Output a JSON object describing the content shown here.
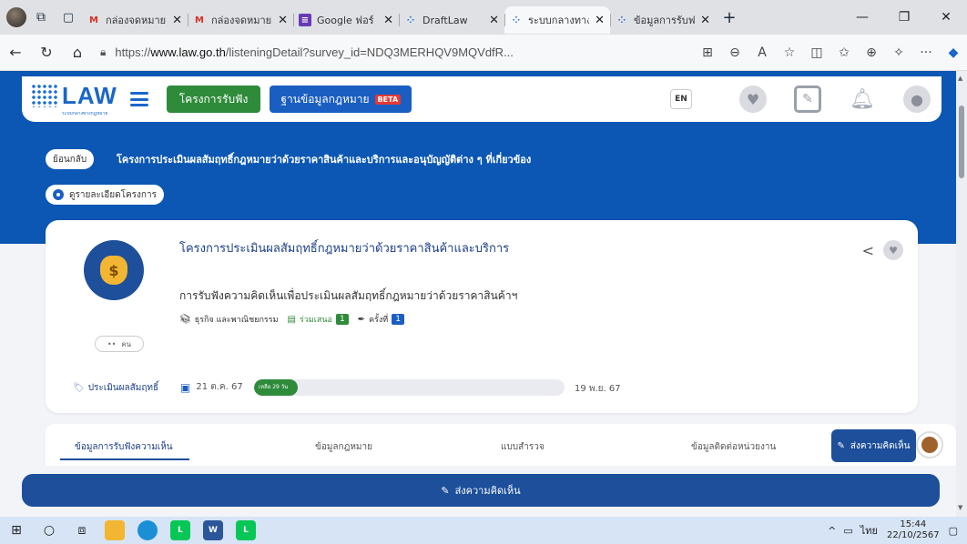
{
  "browser": {
    "tabs": [
      {
        "label": "กล่องจดหมาย",
        "favicon": "gmail-icon",
        "color": "#d93025",
        "active": false
      },
      {
        "label": "กล่องจดหมาย",
        "favicon": "gmail-icon",
        "color": "#d93025",
        "active": false
      },
      {
        "label": "Google ฟอร์",
        "favicon": "google-forms-icon",
        "color": "#673ab7",
        "active": false
      },
      {
        "label": "DraftLaw",
        "favicon": "law-icon",
        "color": "#1a66c9",
        "active": false
      },
      {
        "label": "ระบบกลางทาง",
        "favicon": "law-icon",
        "color": "#1a66c9",
        "active": true
      },
      {
        "label": "ข้อมูลการรับฟ",
        "favicon": "law-icon",
        "color": "#1a66c9",
        "active": false
      }
    ],
    "new_tab": "+",
    "url_prefix": "https://",
    "url_host": "www.law.go.th",
    "url_path": "/listeningDetail?survey_id=NDQ3MERHQV9MQVdfR..."
  },
  "site": {
    "logo_text": "LAW",
    "logo_sub": "ระบบกลางทางกฎหมาย",
    "btn_listening": "โครงการรับฟัง",
    "btn_database": "ฐานข้อมูลกฎหมาย",
    "beta": "BETA",
    "lang": "EN"
  },
  "banner": {
    "back": "ย้อนกลับ",
    "title": "โครงการประเมินผลสัมฤทธิ์กฎหมายว่าด้วยราคาสินค้าและบริการและอนุบัญญัติต่าง ๆ ที่เกี่ยวข้อง",
    "detail": "ดูรายละเอียดโครงการ"
  },
  "card": {
    "title": "โครงการประเมินผลสัมฤทธิ์กฎหมายว่าด้วยราคาสินค้าและบริการ",
    "subtitle": "การรับฟังความคิดเห็นเพื่อประเมินผลสัมฤทธิ์กฎหมายว่าด้วยราคาสินค้าฯ",
    "category": "ธุรกิจ และพาณิชยกรรม",
    "joined_label": "ร่วมเสนอ",
    "joined_count": "1",
    "round_label": "ครั้งที่",
    "round_count": "1",
    "people": "คน",
    "type": "ประเมินผลสัมฤทธิ์",
    "date_start": "21 ต.ค. 67",
    "remaining": "เหลือ 29 วัน",
    "date_end": "19 พ.ย. 67",
    "progress": 0.08
  },
  "tabs": [
    {
      "label": "ข้อมูลการรับฟังความเห็น",
      "active": true
    },
    {
      "label": "ข้อมูลกฎหมาย",
      "active": false
    },
    {
      "label": "แบบสำรวจ",
      "active": false
    },
    {
      "label": "ข้อมูลติดต่อหน่วยงาน",
      "active": false
    }
  ],
  "send_small": "ส่งความคิดเห็น",
  "send_big": "ส่งความคิดเห็น",
  "taskbar": {
    "lang": "ไทย",
    "time": "15:44",
    "date": "22/10/2567"
  },
  "colors": {
    "brand_blue": "#0b57b3",
    "green": "#2e8b3a",
    "navy": "#1d4f9b",
    "beta_red": "#e53935"
  }
}
